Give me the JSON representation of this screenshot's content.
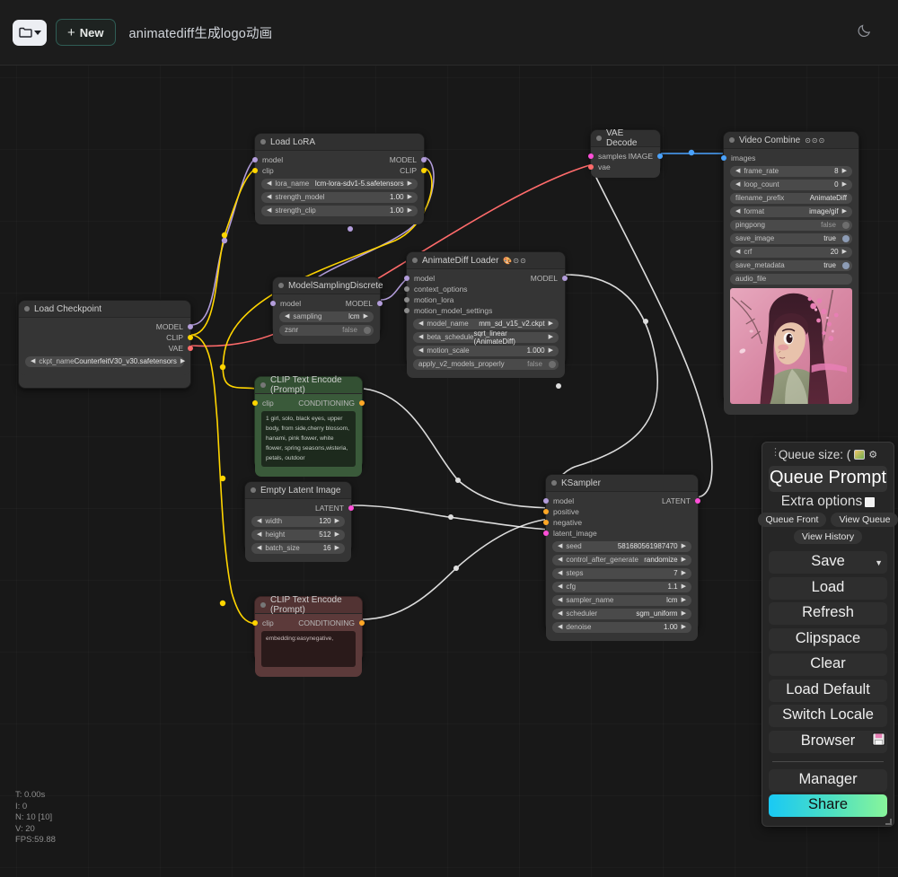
{
  "topbar": {
    "folder_icon": "folder-icon",
    "dropdown_icon": "chevron-down-icon",
    "new_label": "New",
    "new_plus": "+",
    "workflow_title": "animatediff生成logo动画",
    "theme_icon": "moon-icon"
  },
  "nodes": {
    "load_checkpoint": {
      "title": "Load Checkpoint",
      "outputs": [
        "MODEL",
        "CLIP",
        "VAE"
      ],
      "widgets": [
        {
          "name": "ckpt_name",
          "value": "CounterfeitV30_v30.safetensors"
        }
      ]
    },
    "load_lora": {
      "title": "Load LoRA",
      "inputs": [
        "model",
        "clip"
      ],
      "outputs": [
        "MODEL",
        "CLIP"
      ],
      "widgets": [
        {
          "name": "lora_name",
          "value": "lcm-lora-sdv1-5.safetensors"
        },
        {
          "name": "strength_model",
          "value": "1.00"
        },
        {
          "name": "strength_clip",
          "value": "1.00"
        }
      ]
    },
    "model_sampling_discrete": {
      "title": "ModelSamplingDiscrete",
      "inputs": [
        "model"
      ],
      "outputs": [
        "MODEL"
      ],
      "widgets": [
        {
          "name": "sampling",
          "value": "lcm"
        },
        {
          "name": "zsnr",
          "value": "false"
        }
      ]
    },
    "animatediff_loader": {
      "title": "AnimateDiff Loader",
      "badges": "🎨⊙⊙",
      "inputs": [
        "model",
        "context_options",
        "motion_lora",
        "motion_model_settings"
      ],
      "outputs": [
        "MODEL"
      ],
      "widgets": [
        {
          "name": "model_name",
          "value": "mm_sd_v15_v2.ckpt"
        },
        {
          "name": "beta_schedule",
          "value": "sqrt_linear (AnimateDiff)"
        },
        {
          "name": "motion_scale",
          "value": "1.000"
        },
        {
          "name": "apply_v2_models_properly",
          "value": "false"
        }
      ]
    },
    "clip_text_encode_positive": {
      "title": "CLIP Text Encode (Prompt)",
      "inputs": [
        "clip"
      ],
      "outputs": [
        "CONDITIONING"
      ],
      "text": "1 girl, solo, black eyes, upper body, from side,cherry blossom, hanami, pink flower, white flower, spring seasons,wisteria, petals, outdoor"
    },
    "clip_text_encode_negative": {
      "title": "CLIP Text Encode (Prompt)",
      "inputs": [
        "clip"
      ],
      "outputs": [
        "CONDITIONING"
      ],
      "text": "embedding:easynegative,"
    },
    "empty_latent_image": {
      "title": "Empty Latent Image",
      "outputs": [
        "LATENT"
      ],
      "widgets": [
        {
          "name": "width",
          "value": "120"
        },
        {
          "name": "height",
          "value": "512"
        },
        {
          "name": "batch_size",
          "value": "16"
        }
      ]
    },
    "ksampler": {
      "title": "KSampler",
      "inputs": [
        "model",
        "positive",
        "negative",
        "latent_image"
      ],
      "outputs": [
        "LATENT"
      ],
      "widgets": [
        {
          "name": "seed",
          "value": "581680561987470"
        },
        {
          "name": "control_after_generate",
          "value": "randomize"
        },
        {
          "name": "steps",
          "value": "7"
        },
        {
          "name": "cfg",
          "value": "1.1"
        },
        {
          "name": "sampler_name",
          "value": "lcm"
        },
        {
          "name": "scheduler",
          "value": "sgm_uniform"
        },
        {
          "name": "denoise",
          "value": "1.00"
        }
      ]
    },
    "vae_decode": {
      "title": "VAE Decode",
      "inputs": [
        "samples",
        "vae"
      ],
      "outputs": [
        "IMAGE"
      ]
    },
    "video_combine": {
      "title": "Video Combine",
      "badges": "⊙⊙⊙",
      "inputs": [
        "images"
      ],
      "widgets": [
        {
          "name": "frame_rate",
          "value": "8"
        },
        {
          "name": "loop_count",
          "value": "0"
        },
        {
          "name": "filename_prefix",
          "value": "AnimateDiff"
        },
        {
          "name": "format",
          "value": "image/gif"
        },
        {
          "name": "pingpong",
          "value": "false"
        },
        {
          "name": "save_image",
          "value": "true"
        },
        {
          "name": "crf",
          "value": "20"
        },
        {
          "name": "save_metadata",
          "value": "true"
        },
        {
          "name": "audio_file",
          "value": ""
        }
      ]
    }
  },
  "menu": {
    "queue_size_label": "Queue size: (",
    "image_icon": "image-icon",
    "gear_icon": "gear-icon",
    "queue_prompt": "Queue Prompt",
    "extra_options": "Extra options",
    "queue_front": "Queue Front",
    "view_queue": "View Queue",
    "view_history": "View History",
    "save": "Save",
    "save_caret": "▼",
    "load": "Load",
    "refresh": "Refresh",
    "clipspace": "Clipspace",
    "clear": "Clear",
    "load_default": "Load Default",
    "switch_locale": "Switch Locale",
    "browser": "Browser",
    "browser_icon": "floppy-disk-icon",
    "manager": "Manager",
    "share": "Share"
  },
  "stats": {
    "time": "T: 0.00s",
    "iterations": "I: 0",
    "nodes": "N: 10 [10]",
    "version": "V: 20",
    "fps": "FPS:59.88"
  },
  "colors": {
    "model_link": "#b39ddb",
    "clip_link": "#ffd500",
    "vae_link": "#ff6b6b",
    "conditioning_link": "#ffa726",
    "latent_link": "#ff4fd8",
    "image_link": "#4aa3ff",
    "default_link": "#e8e8e8",
    "accent_share_start": "#19c9f5",
    "accent_share_end": "#88f59a"
  }
}
